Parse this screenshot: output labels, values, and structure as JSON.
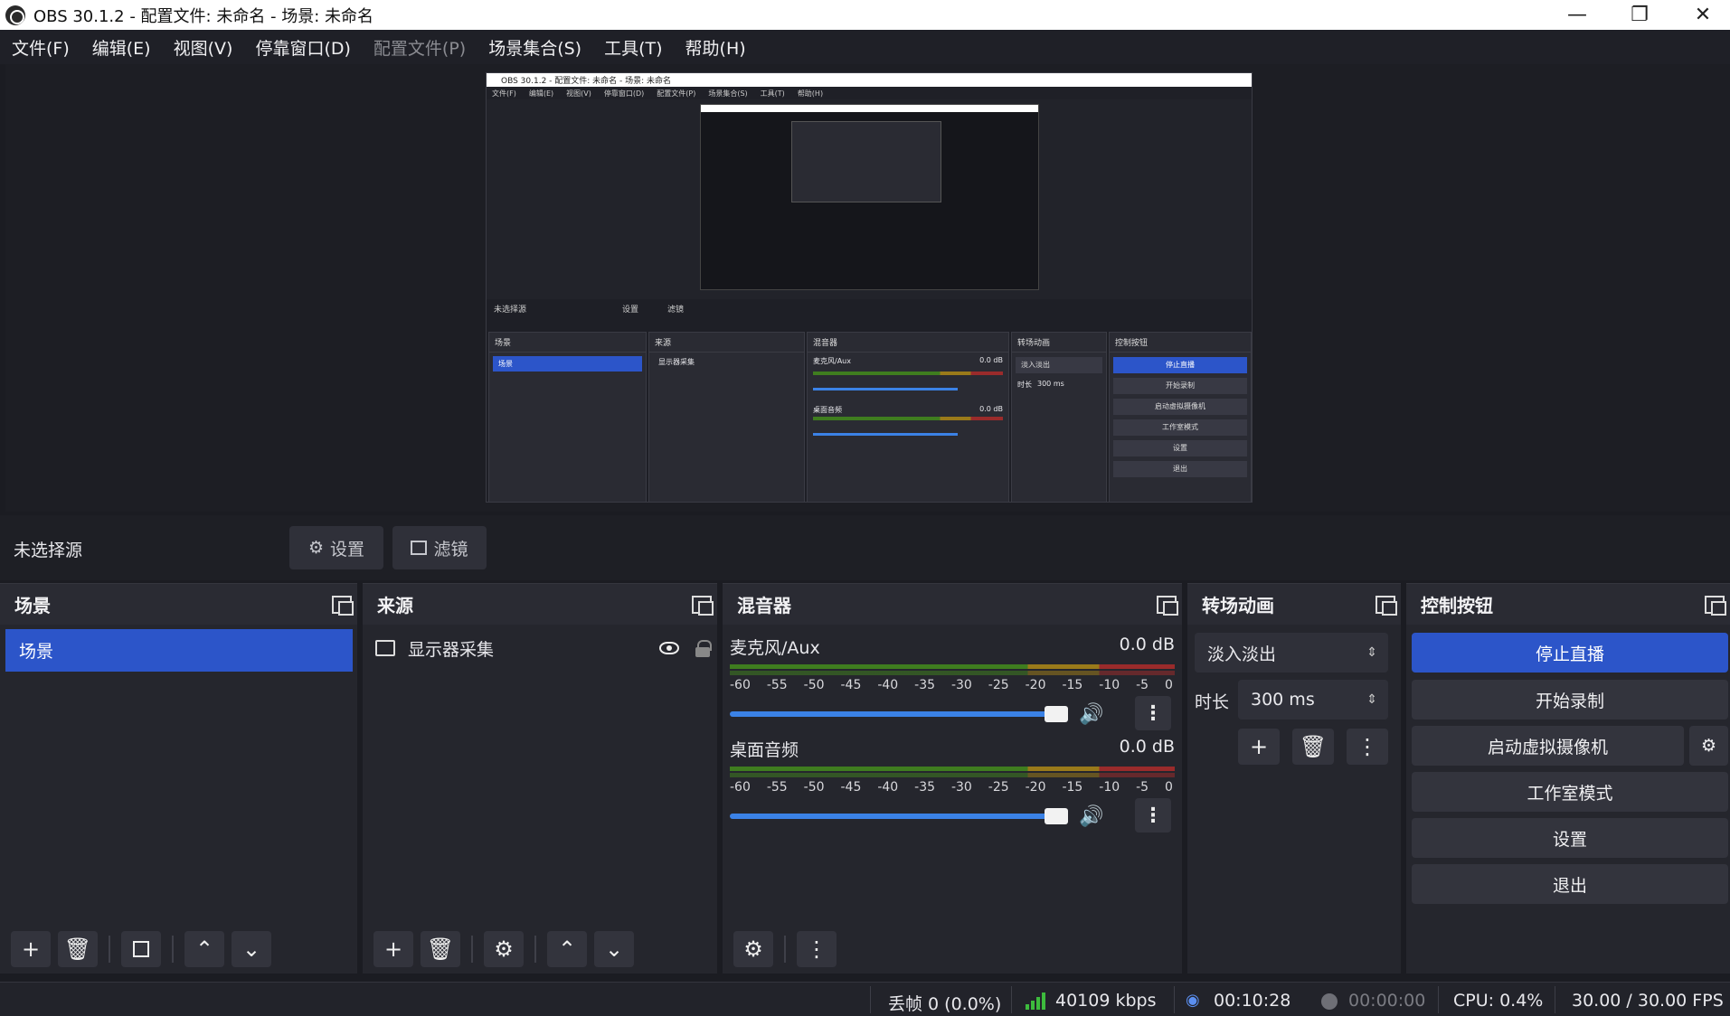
{
  "window": {
    "title": "OBS 30.1.2 - 配置文件: 未命名 - 场景: 未命名",
    "minimize": "—",
    "restore": "❐",
    "close": "✕"
  },
  "menu": {
    "file": "文件(F)",
    "edit": "编辑(E)",
    "view": "视图(V)",
    "docks": "停靠窗口(D)",
    "profile": "配置文件(P)",
    "scene_collection": "场景集合(S)",
    "tools": "工具(T)",
    "help": "帮助(H)"
  },
  "preview": {
    "title": "OBS 30.1.2 - 配置文件: 未命名 - 场景: 未命名",
    "menu": [
      "文件(F)",
      "编辑(E)",
      "视图(V)",
      "停靠窗口(D)",
      "配置文件(P)",
      "场景集合(S)",
      "工具(T)",
      "帮助(H)"
    ],
    "no_source": "未选择源",
    "settings": "设置",
    "filters": "滤镜",
    "scenes": "场景",
    "sources": "来源",
    "mixer": "混音器",
    "transitions": "转场动画",
    "controls": "控制按钮",
    "scene_item": "场景",
    "source_item": "显示器采集",
    "mic": "麦克风/Aux",
    "desktop": "桌面音频",
    "db": "0.0 dB",
    "fade": "淡入淡出",
    "duration_label": "时长",
    "duration": "300 ms",
    "btn_stop_stream": "停止直播",
    "btn_record": "开始录制",
    "btn_vcam": "启动虚拟摄像机",
    "btn_studio": "工作室模式",
    "btn_settings": "设置",
    "btn_exit": "退出"
  },
  "source_bar": {
    "no_source": "未选择源",
    "settings_label": "设置",
    "filters_label": "滤镜"
  },
  "scenes": {
    "title": "场景",
    "items": [
      "场景"
    ]
  },
  "sources": {
    "title": "来源",
    "items": [
      "显示器采集"
    ]
  },
  "mixer": {
    "title": "混音器",
    "ticks": [
      "-60",
      "-55",
      "-50",
      "-45",
      "-40",
      "-35",
      "-30",
      "-25",
      "-20",
      "-15",
      "-10",
      "-5",
      "0"
    ],
    "channels": [
      {
        "name": "麦克风/Aux",
        "level": "0.0 dB"
      },
      {
        "name": "桌面音频",
        "level": "0.0 dB"
      }
    ]
  },
  "transitions": {
    "title": "转场动画",
    "transition": "淡入淡出",
    "duration_label": "时长",
    "duration_value": "300 ms"
  },
  "controls": {
    "title": "控制按钮",
    "stop_stream": "停止直播",
    "start_record": "开始录制",
    "start_vcam": "启动虚拟摄像机",
    "studio_mode": "工作室模式",
    "settings": "设置",
    "exit": "退出"
  },
  "status": {
    "dropped_frames": "丢帧 0 (0.0%)",
    "bitrate": "40109 kbps",
    "stream_time": "00:10:28",
    "record_time": "00:00:00",
    "cpu": "CPU: 0.4%",
    "fps": "30.00 / 30.00 FPS"
  },
  "colors": {
    "accent": "#2c55c9",
    "background": "#1b1c22",
    "dock": "#25262d",
    "meter_green": "#3f7d1f",
    "meter_yellow": "#9a7a1a",
    "meter_red": "#9a2b2b",
    "bitrate_signal": "#3dbb3d"
  }
}
